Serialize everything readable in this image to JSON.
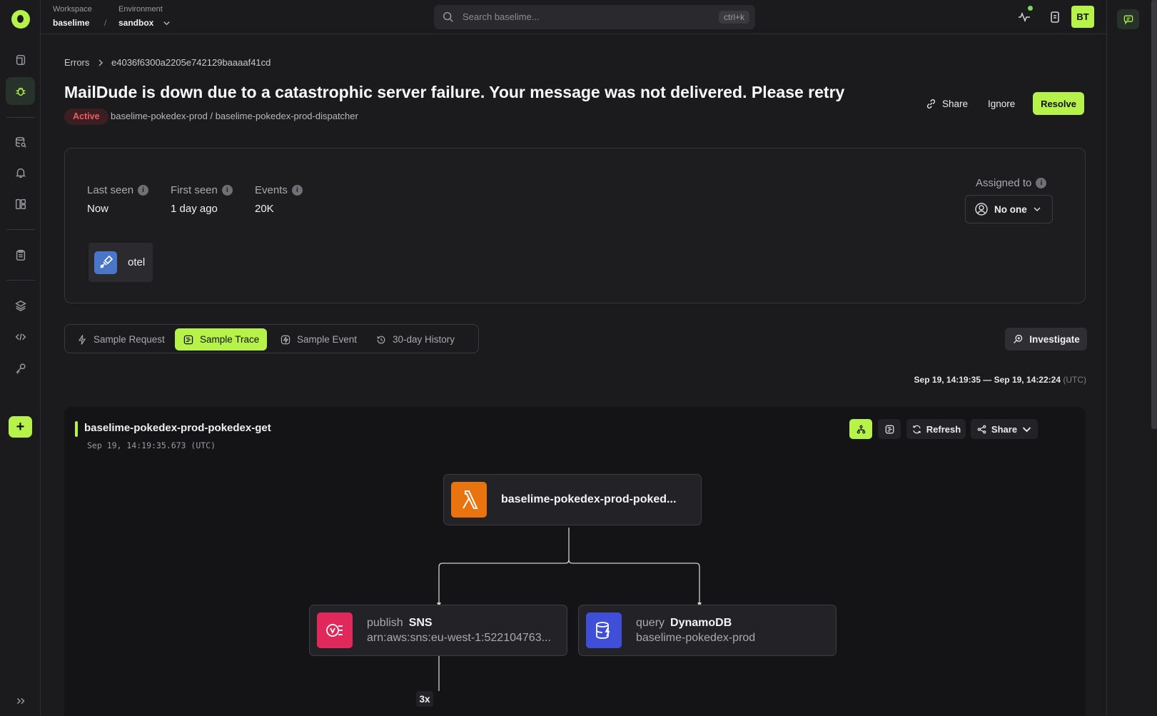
{
  "topbar": {
    "workspace_label": "Workspace",
    "workspace_value": "baselime",
    "environment_label": "Environment",
    "environment_value": "sandbox",
    "separator": "/",
    "search_placeholder": "Search baselime...",
    "search_shortcut": "ctrl+k",
    "avatar_initials": "BT"
  },
  "breadcrumb": {
    "root": "Errors",
    "current": "e4036f6300a2205e742129baaaaf41cd"
  },
  "error": {
    "title": "MailDude is down due to a catastrophic server failure. Your message was not delivered. Please retry",
    "status": "Active",
    "path": "baselime-pokedex-prod / baselime-pokedex-prod-dispatcher"
  },
  "actions": {
    "share": "Share",
    "ignore": "Ignore",
    "resolve": "Resolve"
  },
  "stats": {
    "last_seen_label": "Last seen",
    "last_seen_value": "Now",
    "first_seen_label": "First seen",
    "first_seen_value": "1 day ago",
    "events_label": "Events",
    "events_value": "20K",
    "assigned_label": "Assigned to",
    "assigned_value": "No one",
    "source": "otel"
  },
  "tabs": [
    {
      "label": "Sample Request",
      "icon": "bolt-icon"
    },
    {
      "label": "Sample Trace",
      "icon": "trace-icon"
    },
    {
      "label": "Sample Event",
      "icon": "event-icon"
    },
    {
      "label": "30-day History",
      "icon": "history-icon"
    }
  ],
  "active_tab": "Sample Trace",
  "investigate": "Investigate",
  "time_range": {
    "text": "Sep 19, 14:19:35 — Sep 19, 14:22:24",
    "tz": "(UTC)"
  },
  "trace": {
    "name": "baselime-pokedex-prod-pokedex-get",
    "timestamp": "Sep 19, 14:19:35.673 (UTC)",
    "refresh": "Refresh",
    "share": "Share",
    "nodes": {
      "root": {
        "label": "baselime-pokedex-prod-poked..."
      },
      "sns": {
        "op": "publish",
        "service": "SNS",
        "detail": "arn:aws:sns:eu-west-1:522104763..."
      },
      "dynamo": {
        "op": "query",
        "service": "DynamoDB",
        "detail": "baselime-pokedex-prod"
      }
    },
    "multiplier": "3x"
  },
  "colors": {
    "accent": "#b6f24a",
    "danger": "#ef5b64",
    "lambda": "#e8730f",
    "sns": "#e0295a",
    "dynamodb": "#3f4fd8"
  }
}
